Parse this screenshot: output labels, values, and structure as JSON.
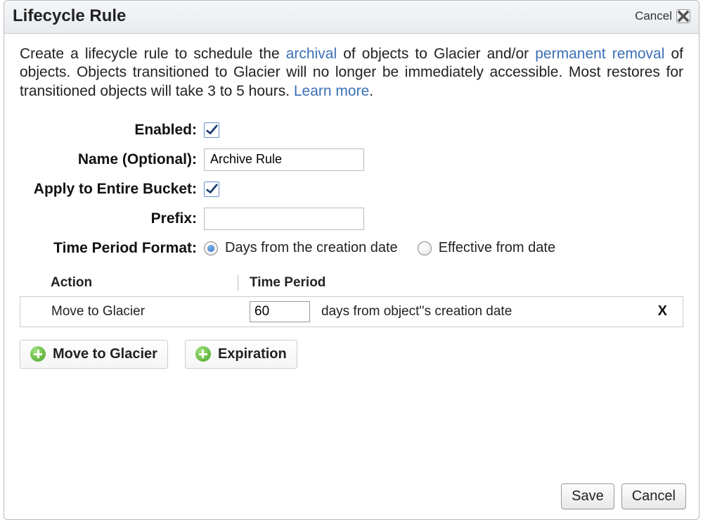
{
  "dialog": {
    "title": "Lifecycle Rule",
    "cancel_top": "Cancel"
  },
  "intro": {
    "pre": "Create a lifecycle rule to schedule the ",
    "link_archival": "archival",
    "mid1": " of objects to Glacier and/or ",
    "link_removal": "permanent removal",
    "mid2": " of objects. Objects transitioned to Glacier will no longer be immediately accessible. Most restores for transitioned objects will take 3 to 5 hours. ",
    "link_learn": "Learn more",
    "period": "."
  },
  "form": {
    "enabled_label": "Enabled:",
    "enabled_checked": true,
    "name_label": "Name (Optional):",
    "name_value": "Archive Rule",
    "bucket_label": "Apply to Entire Bucket:",
    "bucket_checked": true,
    "prefix_label": "Prefix:",
    "prefix_value": "",
    "period_label": "Time Period Format:",
    "period_opt1": "Days from the creation date",
    "period_opt2": "Effective from date",
    "period_selected": "days"
  },
  "table": {
    "col_action": "Action",
    "col_time": "Time Period",
    "rows": [
      {
        "action": "Move to Glacier",
        "value": "60",
        "suffix": "days from object''s creation date"
      }
    ]
  },
  "add": {
    "glacier": "Move to Glacier",
    "expiration": "Expiration"
  },
  "footer": {
    "save": "Save",
    "cancel": "Cancel"
  }
}
